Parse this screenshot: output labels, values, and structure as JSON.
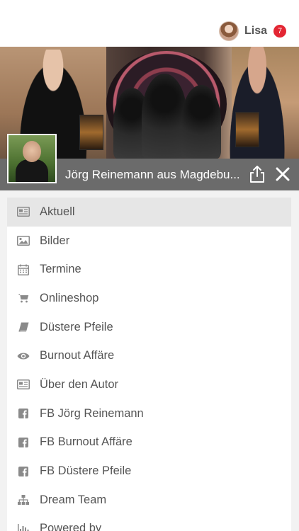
{
  "user": {
    "name": "Lisa",
    "notification_count": "7"
  },
  "header": {
    "title": "Jörg Reinemann aus Magdebu..."
  },
  "menu": {
    "items": [
      {
        "label": "Aktuell",
        "icon": "newspaper-icon"
      },
      {
        "label": "Bilder",
        "icon": "image-icon"
      },
      {
        "label": "Termine",
        "icon": "calendar-icon"
      },
      {
        "label": "Onlineshop",
        "icon": "cart-icon"
      },
      {
        "label": "Düstere Pfeile",
        "icon": "book-icon"
      },
      {
        "label": "Burnout Affäre",
        "icon": "eye-icon"
      },
      {
        "label": "Über den Autor",
        "icon": "newspaper-icon"
      },
      {
        "label": "FB Jörg Reinemann",
        "icon": "facebook-icon"
      },
      {
        "label": "FB Burnout Affäre",
        "icon": "facebook-icon"
      },
      {
        "label": "FB Düstere Pfeile",
        "icon": "facebook-icon"
      },
      {
        "label": "Dream Team",
        "icon": "sitemap-icon"
      },
      {
        "label": "Powered by",
        "icon": "bar-chart-icon"
      }
    ]
  },
  "colors": {
    "badge": "#e32633",
    "title_bar": "#6b6b6b",
    "active_row": "#e6e6e6",
    "icon": "#8a8a8a"
  }
}
